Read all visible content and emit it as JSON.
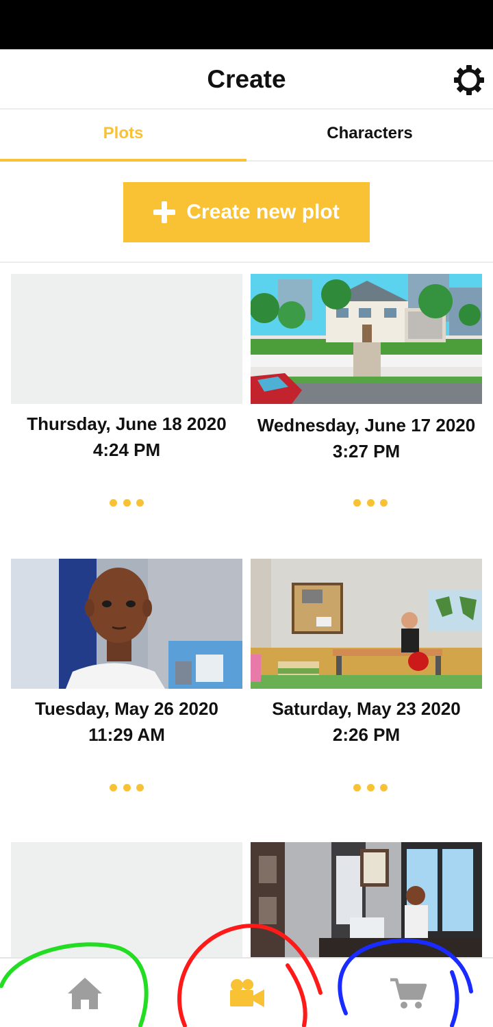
{
  "header": {
    "title": "Create"
  },
  "tabs": [
    {
      "label": "Plots",
      "active": true
    },
    {
      "label": "Characters",
      "active": false
    }
  ],
  "create_button": {
    "label": "Create new plot"
  },
  "plots": [
    {
      "date": "Thursday, June 18 2020",
      "time": "4:24 PM",
      "thumbnail": "blank"
    },
    {
      "date": "Wednesday, June 17 2020",
      "time": "3:27 PM",
      "thumbnail": "house-street-scene"
    },
    {
      "date": "Tuesday, May 26 2020",
      "time": "11:29 AM",
      "thumbnail": "man-in-office"
    },
    {
      "date": "Saturday, May 23 2020",
      "time": "2:26 PM",
      "thumbnail": "classroom-scene"
    },
    {
      "thumbnail": "blank"
    },
    {
      "thumbnail": "office-desk-scene"
    }
  ],
  "bottom_nav": [
    {
      "icon": "home-icon",
      "active": false
    },
    {
      "icon": "video-camera-icon",
      "active": true
    },
    {
      "icon": "shopping-cart-icon",
      "active": false
    }
  ],
  "colors": {
    "accent": "#f9c235",
    "inactive_icon": "#9e9e9e",
    "placeholder": "#eef0ef"
  },
  "annotations": [
    {
      "color": "#22dd22",
      "target": "home-icon"
    },
    {
      "color": "#ff1a1a",
      "target": "video-camera-icon"
    },
    {
      "color": "#1a2bff",
      "target": "shopping-cart-icon"
    }
  ]
}
